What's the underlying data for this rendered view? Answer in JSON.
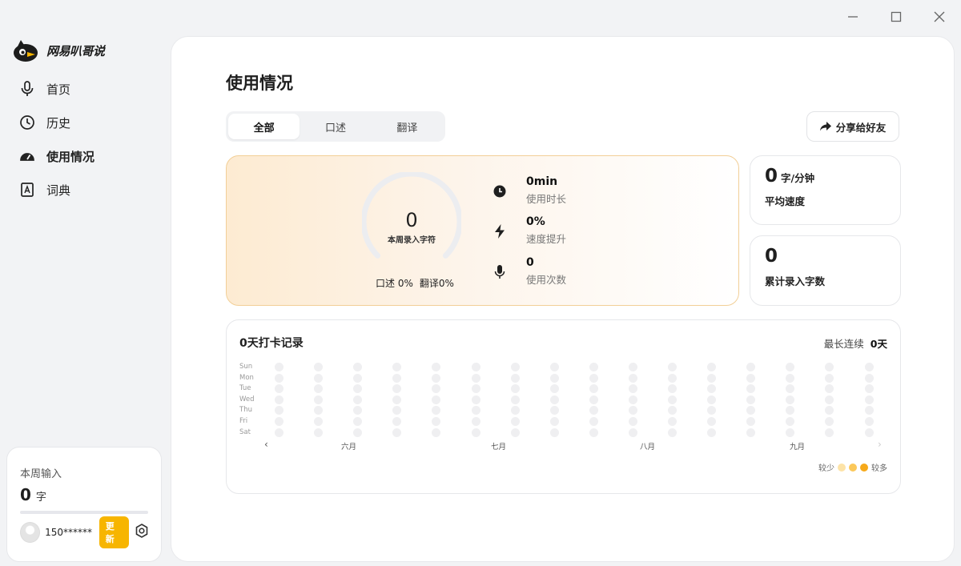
{
  "window": {
    "minimize_icon": "minimize-icon",
    "maximize_icon": "maximize-icon",
    "close_icon": "close-icon"
  },
  "brand": {
    "name": "网易叭哥说"
  },
  "sidebar": {
    "items": [
      {
        "label": "首页",
        "icon": "microphone-icon"
      },
      {
        "label": "历史",
        "icon": "clock-icon"
      },
      {
        "label": "使用情况",
        "icon": "speedometer-icon",
        "active": true
      },
      {
        "label": "词典",
        "icon": "dictionary-icon"
      }
    ],
    "week": {
      "title": "本周输入",
      "value": "0",
      "unit": "字"
    },
    "user": {
      "phone": "150******",
      "update_label": "更新"
    }
  },
  "main": {
    "title": "使用情况",
    "tabs": [
      {
        "label": "全部",
        "active": true
      },
      {
        "label": "口述"
      },
      {
        "label": "翻译"
      }
    ],
    "share_label": "分享给好友",
    "stats": {
      "total": "0",
      "total_label": "本周录入字符",
      "dictation": "口述 0%",
      "translation": "翻译0%",
      "metrics": [
        {
          "value": "0min",
          "label": "使用时长",
          "icon": "clock-icon"
        },
        {
          "value": "0%",
          "label": "速度提升",
          "icon": "lightning-icon"
        },
        {
          "value": "0",
          "label": "使用次数",
          "icon": "microphone-icon"
        }
      ]
    },
    "speed": {
      "value": "0",
      "unit": "字/分钟",
      "label": "平均速度"
    },
    "cumulative": {
      "value": "0",
      "label": "累计录入字数"
    },
    "checkin": {
      "title": "0天打卡记录",
      "longest_label": "最长连续",
      "longest_value": "0天",
      "days": [
        "Sun",
        "Mon",
        "Tue",
        "Wed",
        "Thu",
        "Fri",
        "Sat"
      ],
      "months": [
        "六月",
        "七月",
        "八月",
        "九月"
      ],
      "legend_less": "较少",
      "legend_more": "较多",
      "legend_colors": [
        "#fde3a7",
        "#fbc85a",
        "#f6a91a"
      ]
    }
  }
}
